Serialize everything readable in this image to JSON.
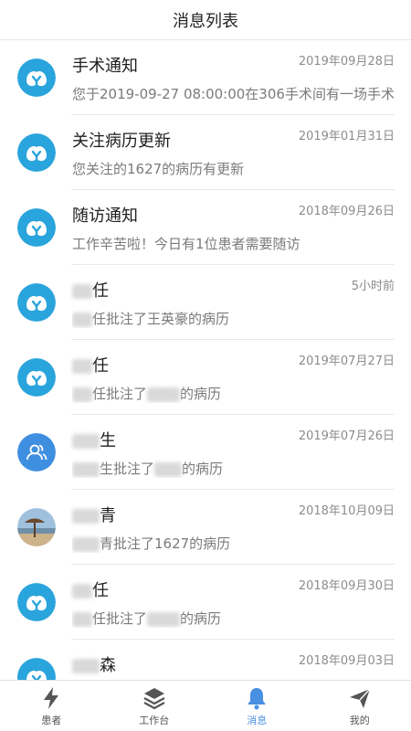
{
  "header": {
    "title": "消息列表"
  },
  "messages": [
    {
      "avatar": "logo-icon",
      "title": "手术通知",
      "title_blur": "",
      "title_suffix": "",
      "time": "2019年09月28日",
      "sub_blur1": "",
      "sub_text": "您于2019-09-27 08:00:00在306手术间有一场手术",
      "sub_blur2": "",
      "sub_tail": ""
    },
    {
      "avatar": "logo-icon",
      "title": "关注病历更新",
      "title_blur": "",
      "title_suffix": "",
      "time": "2019年01月31日",
      "sub_blur1": "",
      "sub_text": "您关注的1627的病历有更新",
      "sub_blur2": "",
      "sub_tail": ""
    },
    {
      "avatar": "logo-icon",
      "title": "随访通知",
      "title_blur": "",
      "title_suffix": "",
      "time": "2018年09月26日",
      "sub_blur1": "",
      "sub_text": "工作辛苦啦！今日有1位患者需要随访",
      "sub_blur2": "",
      "sub_tail": ""
    },
    {
      "avatar": "logo-icon",
      "title": "",
      "title_blur": "w1",
      "title_suffix": "任",
      "time": "5小时前",
      "sub_blur1": "w1",
      "sub_text": "任批注了王英豪的病历",
      "sub_blur2": "",
      "sub_tail": ""
    },
    {
      "avatar": "logo-icon",
      "title": "",
      "title_blur": "w1",
      "title_suffix": "任",
      "time": "2019年07月27日",
      "sub_blur1": "w1",
      "sub_text": "任批注了",
      "sub_blur2": "w3",
      "sub_tail": "的病历"
    },
    {
      "avatar": "person-icon",
      "title": "",
      "title_blur": "w2",
      "title_suffix": "生",
      "time": "2019年07月26日",
      "sub_blur1": "w2",
      "sub_text": "生批注了",
      "sub_blur2": "w2",
      "sub_tail": "的病历"
    },
    {
      "avatar": "photo-avatar",
      "title": "",
      "title_blur": "w2",
      "title_suffix": "青",
      "time": "2018年10月09日",
      "sub_blur1": "w2",
      "sub_text": "青批注了1627的病历",
      "sub_blur2": "",
      "sub_tail": ""
    },
    {
      "avatar": "logo-icon",
      "title": "",
      "title_blur": "w1",
      "title_suffix": "任",
      "time": "2018年09月30日",
      "sub_blur1": "w1",
      "sub_text": "任批注了",
      "sub_blur2": "w3",
      "sub_tail": "的病历"
    },
    {
      "avatar": "logo-icon",
      "title": "",
      "title_blur": "w2",
      "title_suffix": "森",
      "time": "2018年09月03日",
      "sub_blur1": "",
      "sub_text": "",
      "sub_blur2": "",
      "sub_tail": ""
    }
  ],
  "tabs": [
    {
      "label": "患者",
      "icon": "bolt-icon",
      "active": false
    },
    {
      "label": "工作台",
      "icon": "layers-icon",
      "active": false
    },
    {
      "label": "消息",
      "icon": "bell-icon",
      "active": true
    },
    {
      "label": "我的",
      "icon": "send-icon",
      "active": false
    }
  ],
  "colors": {
    "accent": "#4a90e2",
    "logo": "#2aa4dc",
    "person_avatar": "#3f8fe0",
    "time": "#8c8c8c",
    "subtitle": "#7a7a7a"
  }
}
